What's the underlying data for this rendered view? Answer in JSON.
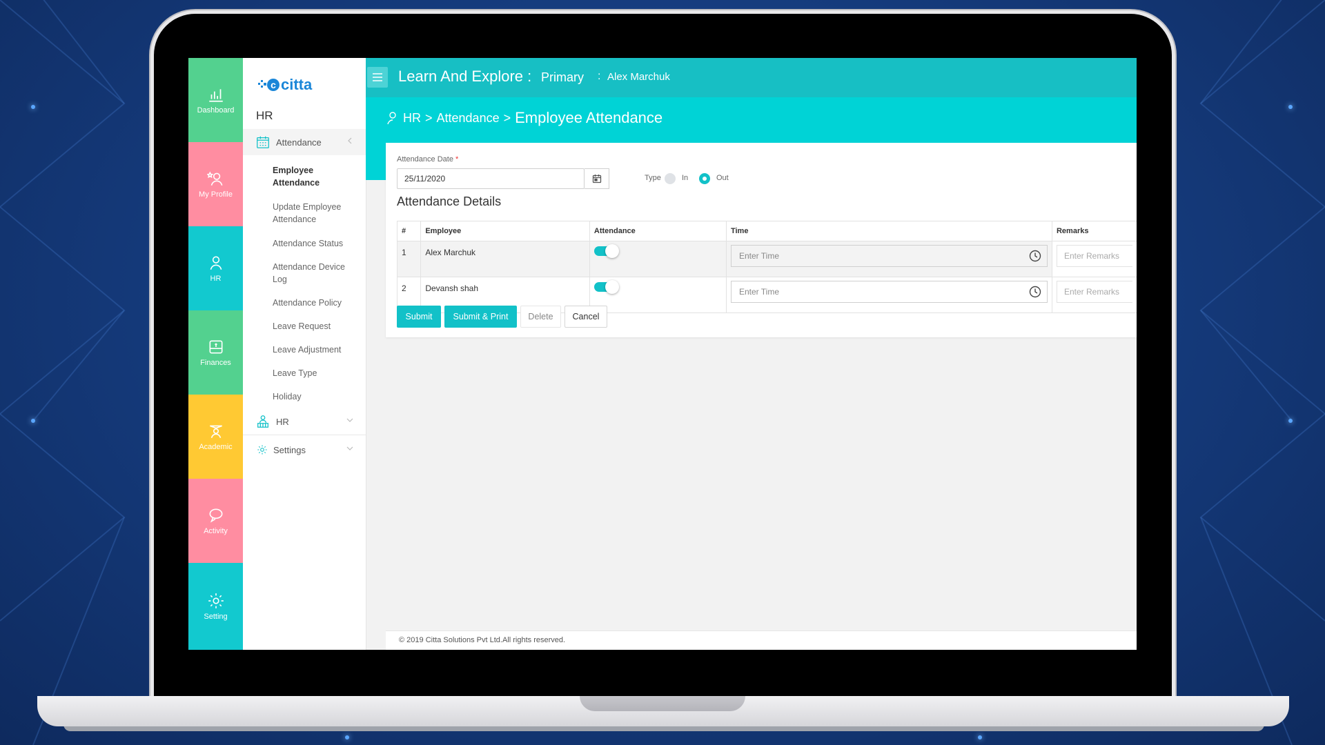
{
  "colors": {
    "accent": "#12c1c8",
    "topbar": "#17bfc4",
    "breadcrumb_band": "#00d3d6",
    "rail_green": "#53d18f",
    "rail_pink": "#ff8da1",
    "rail_teal": "#12c9cf",
    "rail_yellow": "#ffc933"
  },
  "rail": {
    "items": [
      {
        "label": "Dashboard",
        "icon": "bar-chart-icon",
        "color": "#53d18f"
      },
      {
        "label": "My Profile",
        "icon": "profile-star-icon",
        "color": "#ff8da1"
      },
      {
        "label": "HR",
        "icon": "person-icon",
        "color": "#12c9cf"
      },
      {
        "label": "Finances",
        "icon": "wallet-icon",
        "color": "#53d18f"
      },
      {
        "label": "Academic",
        "icon": "graduate-icon",
        "color": "#ffc933"
      },
      {
        "label": "Activity",
        "icon": "chat-bubble-icon",
        "color": "#ff8da1"
      },
      {
        "label": "Setting",
        "icon": "gear-icon",
        "color": "#12c9cf"
      }
    ]
  },
  "sidemenu": {
    "logo_text": "citta",
    "title": "HR",
    "group_attendance": "Attendance",
    "submenu": [
      "Employee Attendance",
      "Update Employee Attendance",
      "Attendance Status",
      "Attendance Device Log",
      "Attendance Policy",
      "Leave Request",
      "Leave Adjustment",
      "Leave Type",
      "Holiday"
    ],
    "group_hr": "HR",
    "group_settings": "Settings"
  },
  "header": {
    "app_title": "Learn And Explore :",
    "branch": "Primary",
    "colon": ":",
    "user": "Alex Marchuk"
  },
  "breadcrumb": {
    "part1": "HR",
    "sep": ">",
    "part2": "Attendance",
    "part3": "Employee Attendance"
  },
  "form": {
    "date_label": "Attendance Date",
    "required_mark": "*",
    "date_value": "25/11/2020",
    "type_label": "Type",
    "type_in": "In",
    "type_out": "Out",
    "type_selected": "Out",
    "section_title": "Attendance Details"
  },
  "table": {
    "headers": [
      "#",
      "Employee",
      "Attendance",
      "Time",
      "Remarks"
    ],
    "rows": [
      {
        "num": "1",
        "employee": "Alex Marchuk",
        "present": true,
        "time_placeholder": "Enter Time",
        "remarks_placeholder": "Enter Remarks"
      },
      {
        "num": "2",
        "employee": "Devansh shah",
        "present": true,
        "time_placeholder": "Enter Time",
        "remarks_placeholder": "Enter Remarks"
      }
    ]
  },
  "buttons": {
    "submit": "Submit",
    "submit_print": "Submit & Print",
    "delete": "Delete",
    "cancel": "Cancel"
  },
  "footer": {
    "copyright": "© 2019 Citta Solutions Pvt Ltd.All rights reserved."
  }
}
